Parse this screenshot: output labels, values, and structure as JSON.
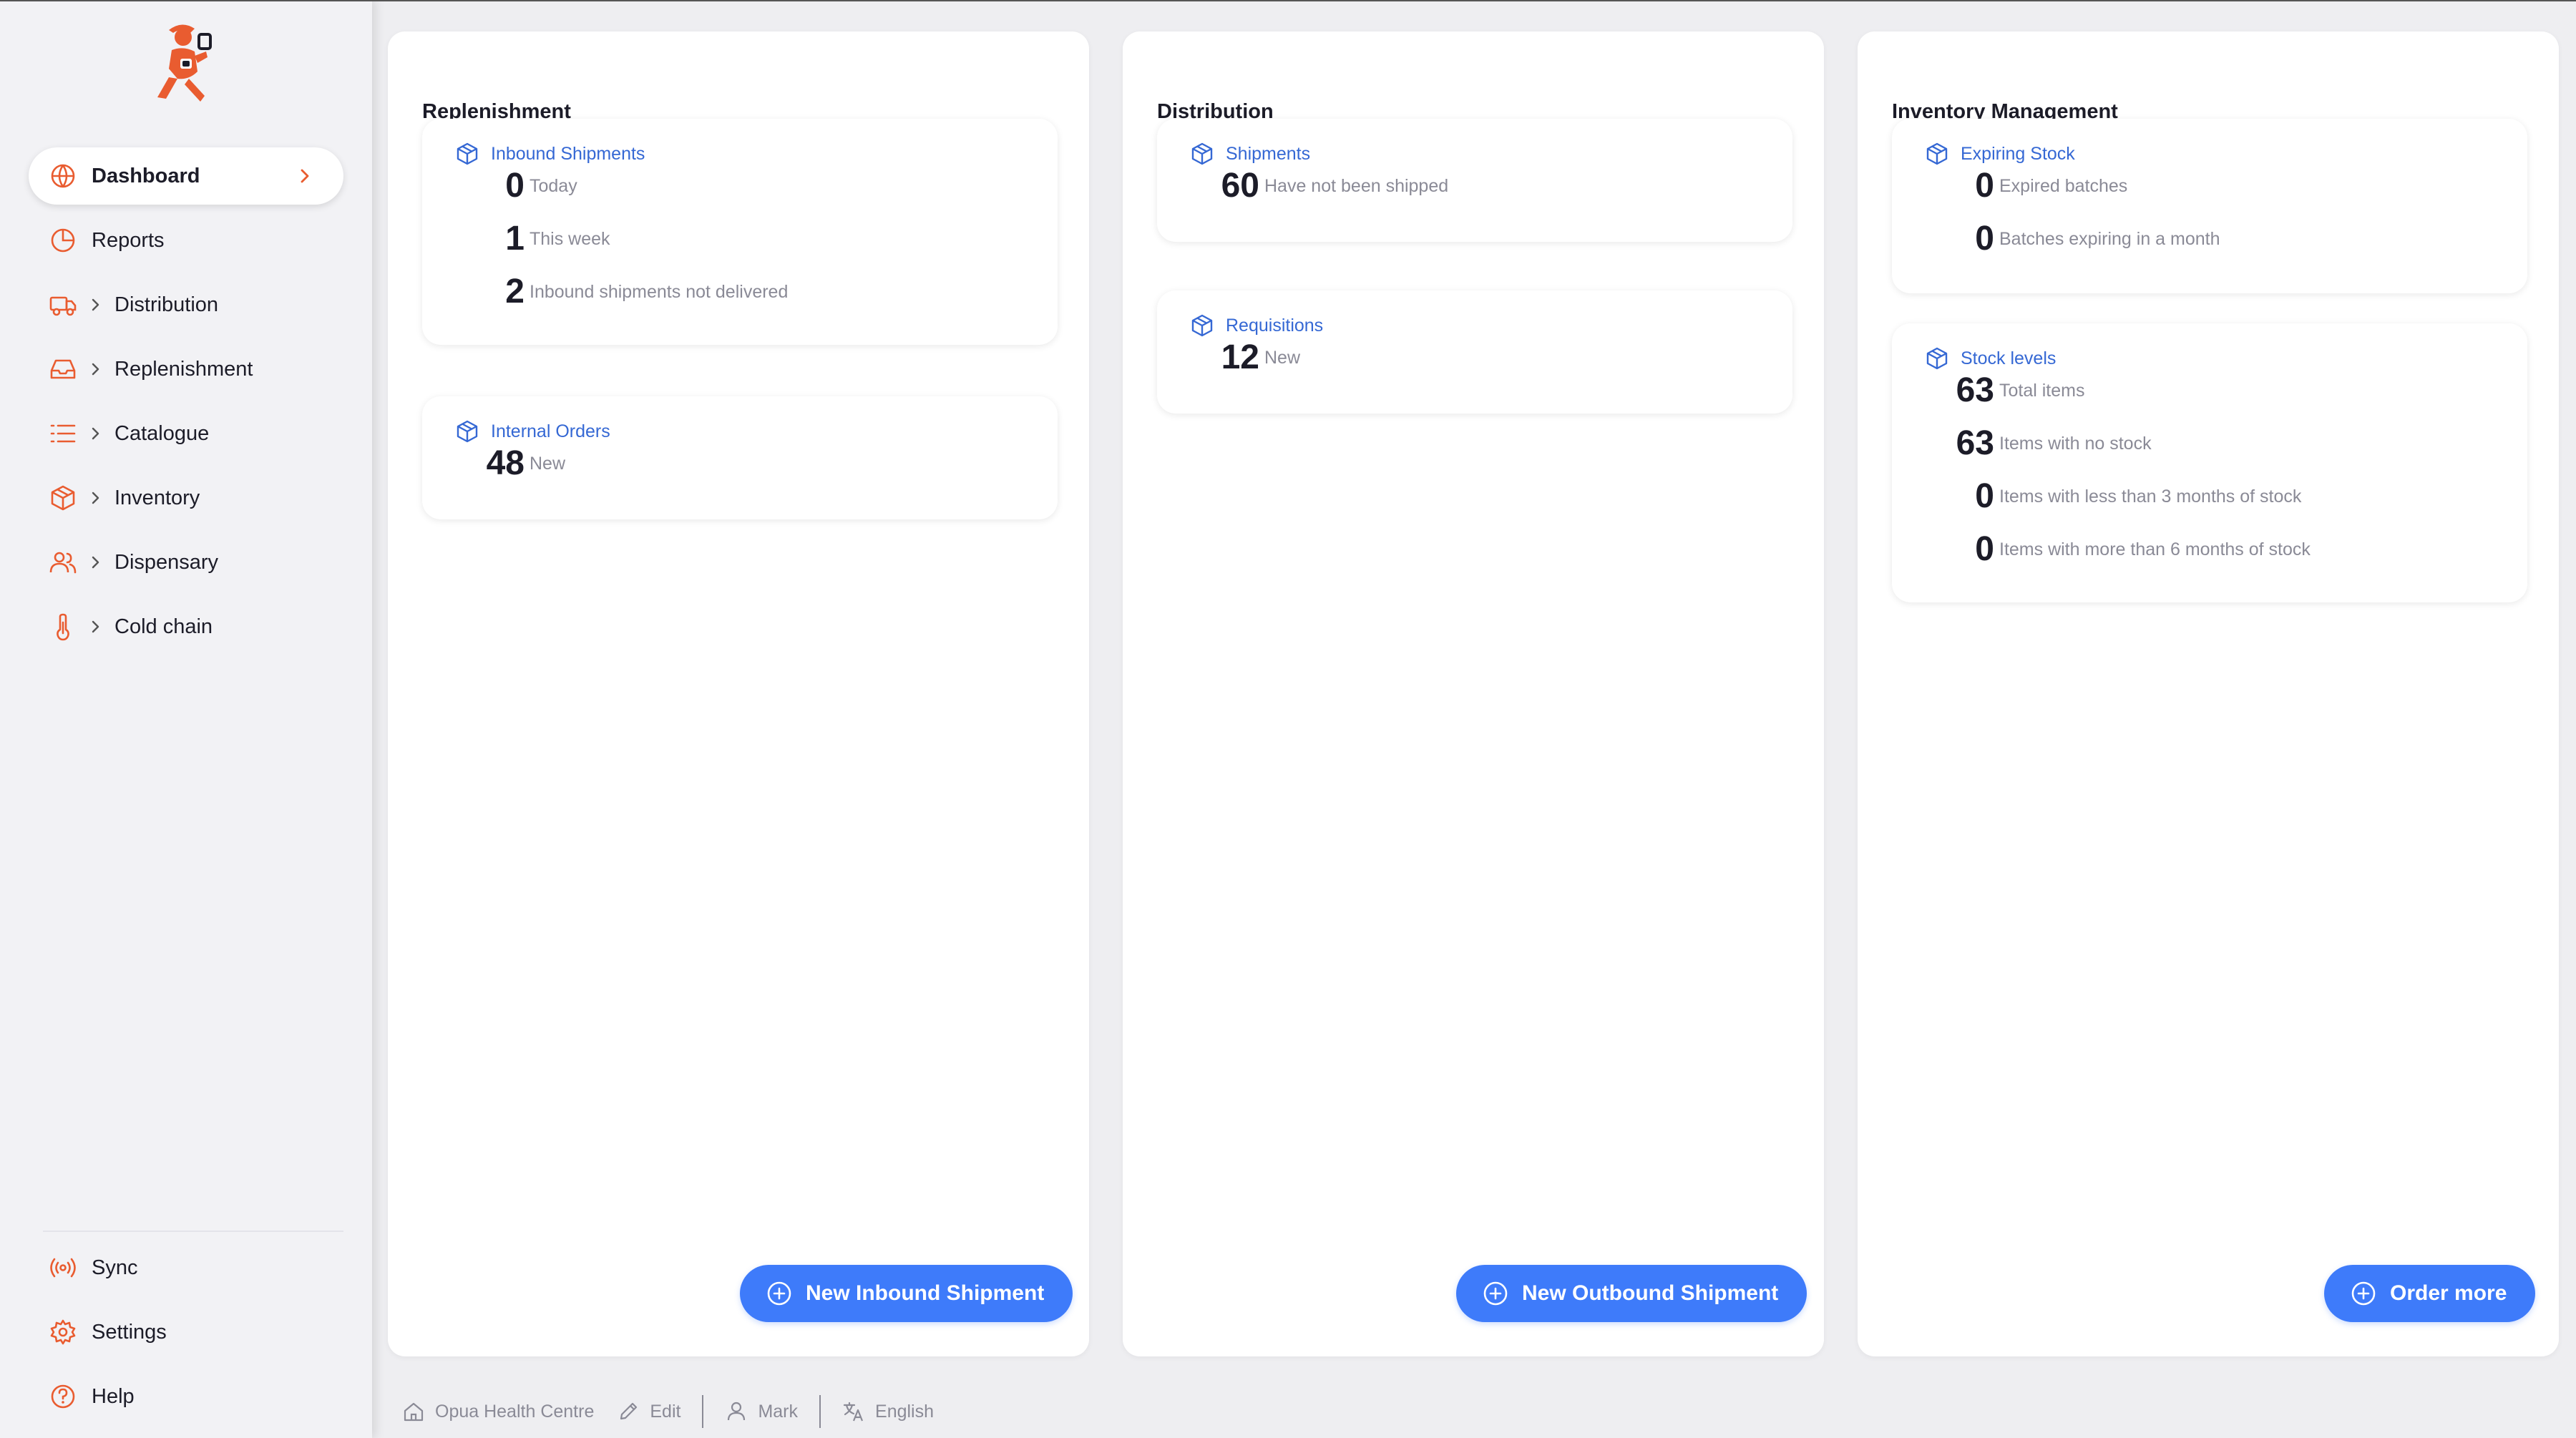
{
  "colors": {
    "brand": "#e95c30",
    "accent": "#3e7bfa",
    "link": "#3568d4"
  },
  "sidebar": {
    "items": [
      {
        "label": "Dashboard",
        "icon": "globe-icon",
        "active": true
      },
      {
        "label": "Reports",
        "icon": "pie-chart-icon"
      },
      {
        "label": "Distribution",
        "icon": "truck-icon"
      },
      {
        "label": "Replenishment",
        "icon": "inbox-icon"
      },
      {
        "label": "Catalogue",
        "icon": "list-icon"
      },
      {
        "label": "Inventory",
        "icon": "cube-icon"
      },
      {
        "label": "Dispensary",
        "icon": "users-icon"
      },
      {
        "label": "Cold chain",
        "icon": "thermometer-icon"
      }
    ],
    "bottom": [
      {
        "label": "Sync",
        "icon": "radio-icon"
      },
      {
        "label": "Settings",
        "icon": "gear-icon"
      },
      {
        "label": "Help",
        "icon": "help-icon"
      }
    ]
  },
  "panels": {
    "replenishment": {
      "title": "Replenishment",
      "inbound": {
        "title": "Inbound Shipments",
        "stats": [
          {
            "value": "0",
            "label": "Today"
          },
          {
            "value": "1",
            "label": "This week"
          },
          {
            "value": "2",
            "label": "Inbound shipments not delivered"
          }
        ]
      },
      "internal": {
        "title": "Internal Orders",
        "stats": [
          {
            "value": "48",
            "label": "New"
          }
        ]
      },
      "button": "New Inbound Shipment"
    },
    "distribution": {
      "title": "Distribution",
      "shipments": {
        "title": "Shipments",
        "stats": [
          {
            "value": "60",
            "label": "Have not been shipped"
          }
        ]
      },
      "requisitions": {
        "title": "Requisitions",
        "stats": [
          {
            "value": "12",
            "label": "New"
          }
        ]
      },
      "button": "New Outbound Shipment"
    },
    "inventory": {
      "title": "Inventory Management",
      "expiring": {
        "title": "Expiring Stock",
        "stats": [
          {
            "value": "0",
            "label": "Expired batches"
          },
          {
            "value": "0",
            "label": "Batches expiring in a month"
          }
        ]
      },
      "stock": {
        "title": "Stock levels",
        "stats": [
          {
            "value": "63",
            "label": "Total items"
          },
          {
            "value": "63",
            "label": "Items with no stock"
          },
          {
            "value": "0",
            "label": "Items with less than 3 months of stock"
          },
          {
            "value": "0",
            "label": "Items with more than 6 months of stock"
          }
        ]
      },
      "button": "Order more"
    }
  },
  "footer": {
    "store": "Opua Health Centre",
    "edit": "Edit",
    "user": "Mark",
    "language": "English"
  }
}
